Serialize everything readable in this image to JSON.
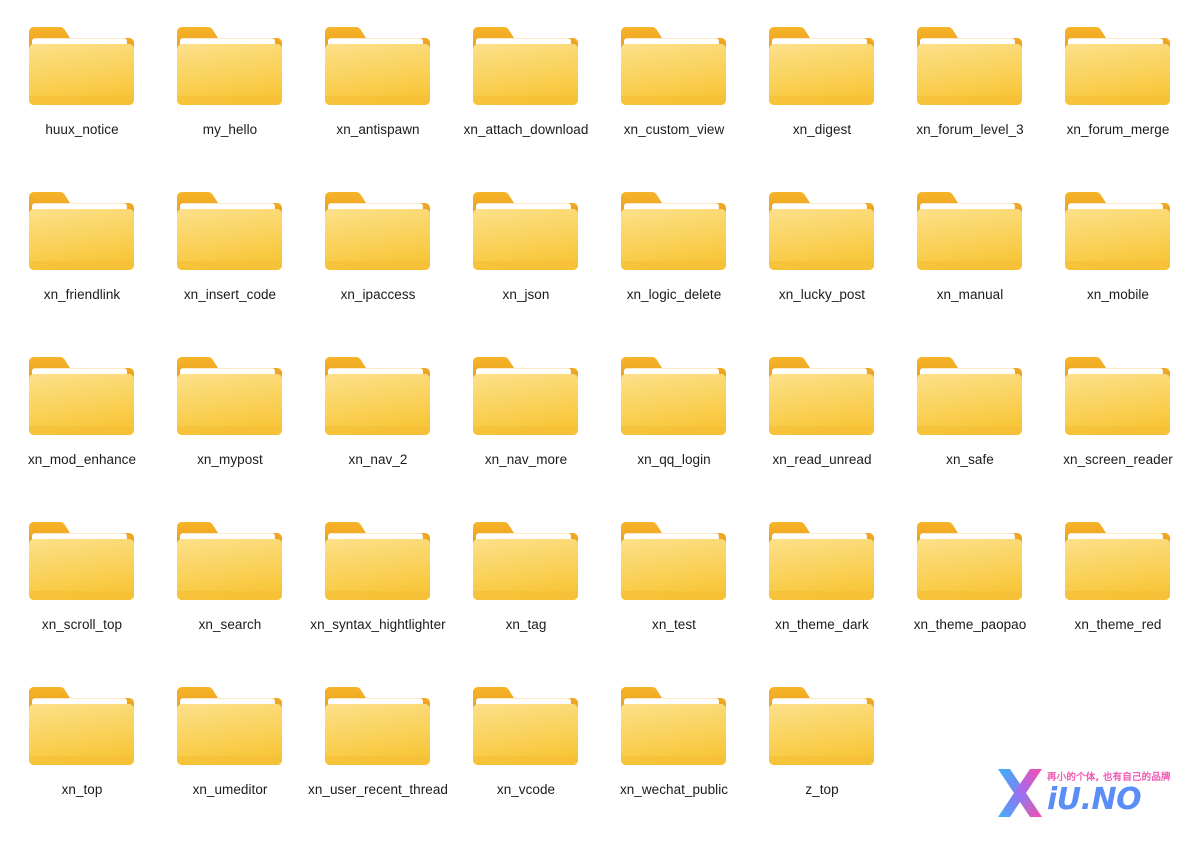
{
  "view": {
    "background_color": "#ffffff",
    "columns": 8,
    "item_type": "folder"
  },
  "folder_icon": {
    "name": "folder-icon",
    "tab_color": "#F2A922",
    "tab_color_dark": "#E9981A",
    "sheet_color": "#FFFFFF",
    "sheet_shadow": "#E8E2D4",
    "front_top_color": "#FCE08A",
    "front_bottom_color": "#F8C63A",
    "front_edge_color": "#EDB32A"
  },
  "folders": [
    {
      "name": "huux_notice"
    },
    {
      "name": "my_hello"
    },
    {
      "name": "xn_antispawn"
    },
    {
      "name": "xn_attach_download"
    },
    {
      "name": "xn_custom_view"
    },
    {
      "name": "xn_digest"
    },
    {
      "name": "xn_forum_level_3"
    },
    {
      "name": "xn_forum_merge"
    },
    {
      "name": "xn_friendlink"
    },
    {
      "name": "xn_insert_code"
    },
    {
      "name": "xn_ipaccess"
    },
    {
      "name": "xn_json"
    },
    {
      "name": "xn_logic_delete"
    },
    {
      "name": "xn_lucky_post"
    },
    {
      "name": "xn_manual"
    },
    {
      "name": "xn_mobile"
    },
    {
      "name": "xn_mod_enhance"
    },
    {
      "name": "xn_mypost"
    },
    {
      "name": "xn_nav_2"
    },
    {
      "name": "xn_nav_more"
    },
    {
      "name": "xn_qq_login"
    },
    {
      "name": "xn_read_unread"
    },
    {
      "name": "xn_safe"
    },
    {
      "name": "xn_screen_reader"
    },
    {
      "name": "xn_scroll_top"
    },
    {
      "name": "xn_search"
    },
    {
      "name": "xn_syntax_hightlighter"
    },
    {
      "name": "xn_tag"
    },
    {
      "name": "xn_test"
    },
    {
      "name": "xn_theme_dark"
    },
    {
      "name": "xn_theme_paopao"
    },
    {
      "name": "xn_theme_red"
    },
    {
      "name": "xn_top"
    },
    {
      "name": "xn_umeditor"
    },
    {
      "name": "xn_user_recent_thread"
    },
    {
      "name": "xn_vcode"
    },
    {
      "name": "xn_wechat_public"
    },
    {
      "name": "z_top"
    }
  ],
  "watermark": {
    "tagline": "再小的个体, 也有自己的品牌",
    "brand": "iU.NO",
    "logo_icon": "x-logo-icon",
    "gradient_start": "#4fa8f5",
    "gradient_mid": "#8b7bf0",
    "gradient_end": "#f64fb0",
    "brand_color": "#5b8df6",
    "tagline_color": "#f25ab4"
  }
}
